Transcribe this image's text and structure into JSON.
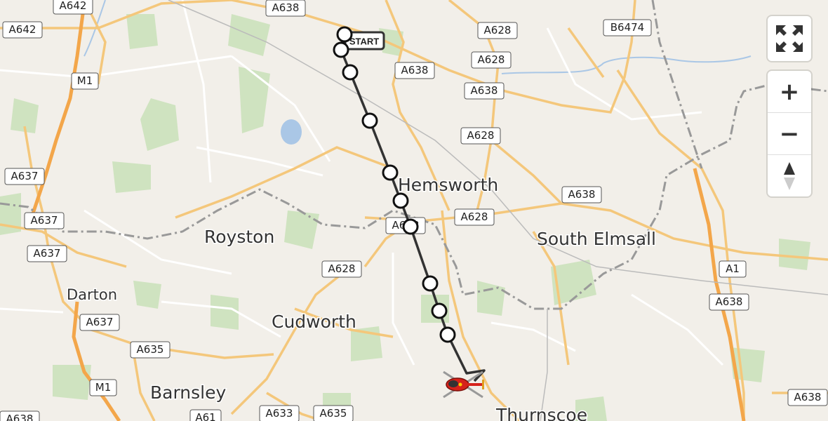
{
  "map": {
    "towns": [
      {
        "id": "hemsworth",
        "name": "Hemsworth"
      },
      {
        "id": "south-elmsall",
        "name": "South Elmsall"
      },
      {
        "id": "royston",
        "name": "Royston"
      },
      {
        "id": "darton",
        "name": "Darton"
      },
      {
        "id": "cudworth",
        "name": "Cudworth"
      },
      {
        "id": "barnsley",
        "name": "Barnsley"
      },
      {
        "id": "thurnscoe",
        "name": "Thurnscoe"
      }
    ],
    "road_labels": [
      "A642",
      "A638",
      "A642",
      "M1",
      "A628",
      "A628",
      "A638",
      "A638",
      "A628",
      "B6474",
      "A637",
      "A637",
      "A637",
      "A638",
      "A628",
      "A638",
      "A628",
      "A637",
      "A635",
      "M1",
      "A633",
      "A635",
      "A61",
      "A638",
      "A1",
      "A638",
      "A638"
    ],
    "start_label": "START",
    "route_waypoints": 11
  },
  "controls": {
    "fullscreen": "fullscreen-icon",
    "zoom_in": "+",
    "zoom_out": "−",
    "north": "compass-icon"
  }
}
